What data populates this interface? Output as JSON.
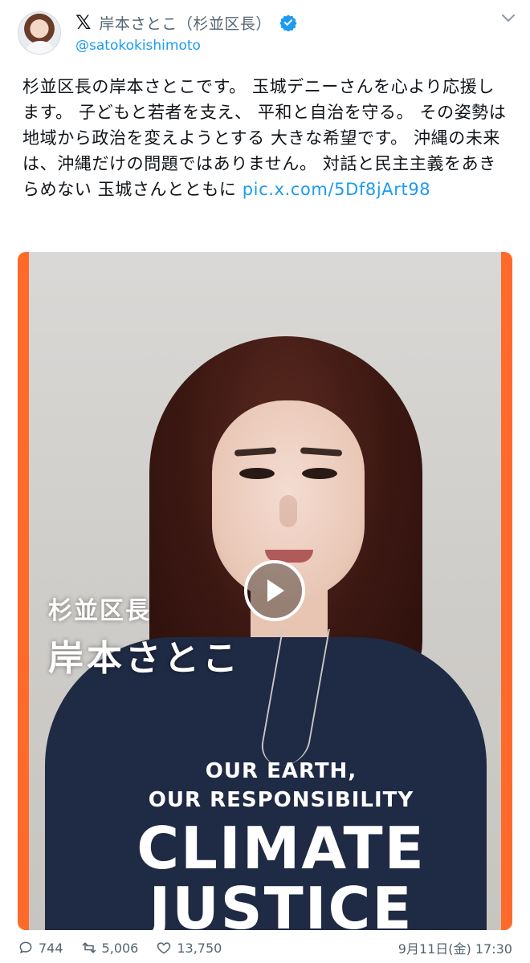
{
  "header": {
    "x_logo": "𝕏",
    "display_name": "岸本さとこ（杉並区長）",
    "handle": "@satokokishimoto"
  },
  "tweet": {
    "text": "杉並区長の岸本さとこです。 玉城デニーさんを心より応援します。 子どもと若者を支え、 平和と自治を守る。 その姿勢は地域から政治を変えようとする 大きな希望です。 沖縄の未来は、沖縄だけの問題ではありません。 対話と民主主義をあきらめない 玉城さんとともに ",
    "link": "pic.x.com/5Df8jArt98"
  },
  "media": {
    "caption_title": "杉並区長",
    "caption_name": "岸本さとこ",
    "shirt_line1": "OUR EARTH,",
    "shirt_line2": "OUR RESPONSIBILITY",
    "shirt_line3": "CLIMATE",
    "shirt_line4": "JUSTICE"
  },
  "footer": {
    "replies": "744",
    "retweets": "5,006",
    "likes": "13,750",
    "timestamp": "9月11日(金) 17:30"
  },
  "colors": {
    "link": "#1d9bf0",
    "media_border": "#ff6a2b",
    "verified": "#1d9bf0"
  }
}
